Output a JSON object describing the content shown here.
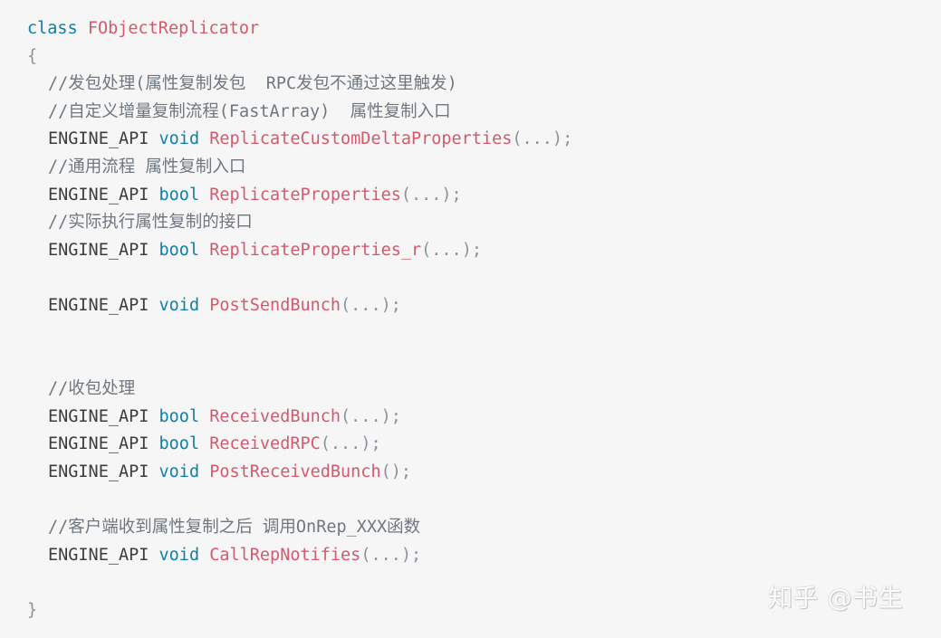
{
  "code": {
    "l1_kw": "class",
    "l1_name": "FObjectReplicator",
    "l2_brace_open": "{",
    "l3_comment": "//发包处理(属性复制发包  RPC发包不通过这里触发)",
    "l4_comment": "//自定义增量复制流程(FastArray)  属性复制入口",
    "l5_prefix": "ENGINE_API",
    "l5_type": "void",
    "l5_fn": "ReplicateCustomDeltaProperties",
    "l5_args": "(...);",
    "l6_comment": "//通用流程 属性复制入口",
    "l7_prefix": "ENGINE_API",
    "l7_type": "bool",
    "l7_fn": "ReplicateProperties",
    "l7_args": "(...);",
    "l8_comment": "//实际执行属性复制的接口",
    "l9_prefix": "ENGINE_API",
    "l9_type": "bool",
    "l9_fn": "ReplicateProperties_r",
    "l9_args": "(...);",
    "l11_prefix": "ENGINE_API",
    "l11_type": "void",
    "l11_fn": "PostSendBunch",
    "l11_args": "(...);",
    "l14_comment": "//收包处理",
    "l15_prefix": "ENGINE_API",
    "l15_type": "bool",
    "l15_fn": "ReceivedBunch",
    "l15_args": "(...);",
    "l16_prefix": "ENGINE_API",
    "l16_type": "bool",
    "l16_fn": "ReceivedRPC",
    "l16_args": "(...);",
    "l17_prefix": "ENGINE_API",
    "l17_type": "void",
    "l17_fn": "PostReceivedBunch",
    "l17_args": "();",
    "l19_comment": "//客户端收到属性复制之后 调用OnRep_XXX函数",
    "l20_prefix": "ENGINE_API",
    "l20_type": "void",
    "l20_fn": "CallRepNotifies",
    "l20_args": "(...);",
    "l22_brace_close": "}"
  },
  "watermark": "知乎 @书生",
  "colors": {
    "background": "#f6f6f6",
    "keyword": "#0e7fa6",
    "function": "#d35a6c",
    "punctuation": "#8b939b",
    "text": "#3d3d3d",
    "comment": "#6f7780"
  }
}
